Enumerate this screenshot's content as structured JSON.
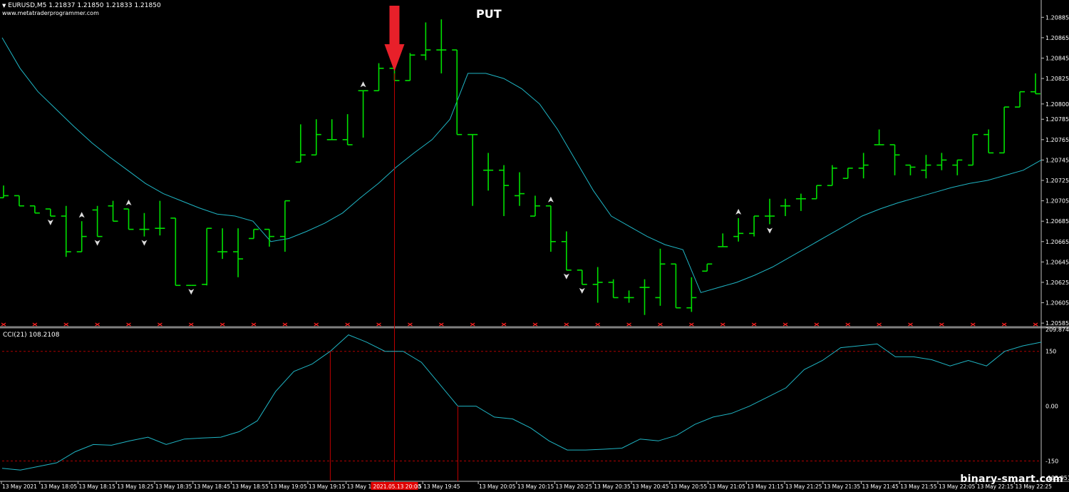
{
  "header": {
    "symbol_line": "EURUSD,M5  1.21837 1.21850 1.21833 1.21850",
    "website": "www.metatraderprogrammer.com"
  },
  "annotation": {
    "signal": "PUT",
    "cursor_time": "2021.05.13 20:00"
  },
  "watermark": "binary-smart.com",
  "colors": {
    "background": "#000000",
    "bar": "#00e000",
    "ma_line": "#1fb5c4",
    "cci_line": "#1fb5c4",
    "marker_red": "#ff2020",
    "cci_level": "#b00000",
    "axis": "#c0c0c0",
    "grid_text": "#ffffff"
  },
  "chart_data": [
    {
      "type": "ohlc",
      "title": "EURUSD,M5",
      "y_ticks": [
        "1.20885",
        "1.20865",
        "1.20845",
        "1.20825",
        "1.20800",
        "1.20785",
        "1.20765",
        "1.20745",
        "1.20725",
        "1.20705",
        "1.20685",
        "1.20665",
        "1.20645",
        "1.20625",
        "1.20605",
        "1.20585"
      ],
      "ylim": [
        1.20583,
        1.20895
      ],
      "bars": [
        [
          1.20708,
          1.2072,
          1.2076,
          1.2071
        ],
        [
          1.2071,
          1.2071,
          1.20718,
          1.207
        ],
        [
          1.207,
          1.207,
          1.207,
          1.20693
        ],
        [
          1.20697,
          1.20697,
          1.20697,
          1.2069
        ],
        [
          1.2069,
          1.207,
          1.2065,
          1.20655
        ],
        [
          1.20655,
          1.20685,
          1.20655,
          1.2067
        ],
        [
          1.20696,
          1.207,
          1.2067,
          1.2067
        ],
        [
          1.207,
          1.20705,
          1.20685,
          1.20685
        ],
        [
          1.20697,
          1.20697,
          1.2068,
          1.20677
        ],
        [
          1.20677,
          1.20693,
          1.2067,
          1.20677
        ],
        [
          1.20678,
          1.20705,
          1.20671,
          1.20678
        ],
        [
          1.20688,
          1.20688,
          1.20622,
          1.20622
        ],
        [
          1.20622,
          1.20622,
          1.20622,
          1.20622
        ],
        [
          1.20623,
          1.20678,
          1.20622,
          1.20678
        ],
        [
          1.20655,
          1.20678,
          1.20648,
          1.20655
        ],
        [
          1.20655,
          1.20678,
          1.2063,
          1.20648
        ],
        [
          1.20668,
          1.20677,
          1.20668,
          1.20677
        ],
        [
          1.20677,
          1.20677,
          1.2066,
          1.2067
        ],
        [
          1.2067,
          1.20705,
          1.20655,
          1.20705
        ],
        [
          1.20743,
          1.2078,
          1.20743,
          1.2075
        ],
        [
          1.2075,
          1.20785,
          1.2075,
          1.2077
        ],
        [
          1.20765,
          1.20785,
          1.20765,
          1.20765
        ],
        [
          1.20765,
          1.2079,
          1.2076,
          1.2076
        ],
        [
          1.20813,
          1.20813,
          1.20767,
          1.20813
        ],
        [
          1.20813,
          1.2084,
          1.20813,
          1.20835
        ],
        [
          1.20835,
          1.20848,
          1.20823,
          1.20823
        ],
        [
          1.20823,
          1.2085,
          1.20823,
          1.20848
        ],
        [
          1.20848,
          1.2088,
          1.20843,
          1.20853
        ],
        [
          1.20853,
          1.20883,
          1.2083,
          1.20853
        ],
        [
          1.20853,
          1.20853,
          1.2077,
          1.2077
        ],
        [
          1.2077,
          1.2077,
          1.207,
          1.2077
        ],
        [
          1.20735,
          1.20752,
          1.20715,
          1.20735
        ],
        [
          1.20735,
          1.2074,
          1.2069,
          1.2072
        ],
        [
          1.2071,
          1.20733,
          1.207,
          1.20712
        ],
        [
          1.2069,
          1.2071,
          1.2069,
          1.207
        ],
        [
          1.207,
          1.207,
          1.20655,
          1.20665
        ],
        [
          1.20665,
          1.20675,
          1.20637,
          1.20637
        ],
        [
          1.20637,
          1.20637,
          1.20623,
          1.20623
        ],
        [
          1.20623,
          1.2064,
          1.20605,
          1.20625
        ],
        [
          1.20625,
          1.20628,
          1.2061,
          1.2061
        ],
        [
          1.2061,
          1.20617,
          1.20605,
          1.2061
        ],
        [
          1.2062,
          1.20628,
          1.20593,
          1.2062
        ],
        [
          1.2061,
          1.20658,
          1.20602,
          1.20643
        ],
        [
          1.20643,
          1.20643,
          1.206,
          1.206
        ],
        [
          1.206,
          1.2063,
          1.20596,
          1.2061
        ],
        [
          1.20636,
          1.20643,
          1.20636,
          1.20643
        ],
        [
          1.2066,
          1.20673,
          1.2066,
          1.2066
        ],
        [
          1.2067,
          1.20688,
          1.20665,
          1.20673
        ],
        [
          1.20673,
          1.2069,
          1.2067,
          1.2069
        ],
        [
          1.2069,
          1.20707,
          1.20682,
          1.2069
        ],
        [
          1.207,
          1.20707,
          1.2069,
          1.207
        ],
        [
          1.20707,
          1.20712,
          1.20695,
          1.20707
        ],
        [
          1.20707,
          1.2072,
          1.2071,
          1.2072
        ],
        [
          1.2072,
          1.2074,
          1.2072,
          1.20737
        ],
        [
          1.20727,
          1.20737,
          1.20727,
          1.20737
        ],
        [
          1.20737,
          1.20752,
          1.20727,
          1.2074
        ],
        [
          1.2076,
          1.20775,
          1.2076,
          1.2076
        ],
        [
          1.2076,
          1.2076,
          1.2073,
          1.2075
        ],
        [
          1.2074,
          1.2074,
          1.2073,
          1.20738
        ],
        [
          1.20735,
          1.2075,
          1.20727,
          1.2074
        ],
        [
          1.2074,
          1.20752,
          1.20735,
          1.20745
        ],
        [
          1.2074,
          1.20745,
          1.2073,
          1.20745
        ],
        [
          1.2074,
          1.2077,
          1.2074,
          1.2077
        ],
        [
          1.2077,
          1.20775,
          1.20755,
          1.20752
        ],
        [
          1.20752,
          1.20797,
          1.20752,
          1.20797
        ],
        [
          1.20797,
          1.2081,
          1.20797,
          1.20812
        ],
        [
          1.20812,
          1.2083,
          1.20812,
          1.2081
        ]
      ],
      "ma": [
        1.20865,
        1.20835,
        1.20812,
        1.20795,
        1.20778,
        1.20762,
        1.20748,
        1.20735,
        1.20722,
        1.20712,
        1.20705,
        1.20698,
        1.20692,
        1.2069,
        1.20685,
        1.20665,
        1.20668,
        1.20675,
        1.20683,
        1.20693,
        1.20708,
        1.20722,
        1.20738,
        1.20752,
        1.20765,
        1.20785,
        1.2083,
        1.2083,
        1.20825,
        1.20815,
        1.208,
        1.20775,
        1.20745,
        1.20715,
        1.2069,
        1.2068,
        1.2067,
        1.20662,
        1.20657,
        1.20615,
        1.2062,
        1.20625,
        1.20632,
        1.2064,
        1.2065,
        1.2066,
        1.2067,
        1.2068,
        1.2069,
        1.20697,
        1.20703,
        1.20708,
        1.20713,
        1.20718,
        1.20722,
        1.20725,
        1.2073,
        1.20735,
        1.20745
      ],
      "ma_x": [
        1,
        3,
        5,
        7,
        9,
        11,
        13,
        15,
        17,
        19,
        21,
        23,
        25,
        27,
        29,
        31,
        33,
        35,
        37,
        39,
        41,
        43,
        45,
        47,
        49,
        51,
        53,
        55,
        57,
        59,
        61,
        63,
        65,
        67,
        69,
        71,
        73,
        75,
        77,
        79,
        81,
        83,
        85,
        87,
        89,
        91,
        93,
        95,
        97,
        99,
        101,
        103,
        105,
        107,
        109,
        111,
        113,
        115,
        117
      ],
      "arrows_up_bars": [
        5,
        8,
        23,
        35,
        47
      ],
      "arrows_down_bars": [
        3,
        6,
        9,
        12,
        36,
        37,
        49
      ],
      "signal_bar": 25
    },
    {
      "type": "line",
      "title": "CCI(21) 108.2108",
      "y_ticks": [
        "209.8741",
        "150",
        "0.00",
        "-150",
        "-195.9519"
      ],
      "ylim": [
        -195.9519,
        209.8741
      ],
      "levels": [
        150,
        -150
      ],
      "values": [
        -170,
        -175,
        -165,
        -155,
        -125,
        -105,
        -107,
        -95,
        -85,
        -105,
        -90,
        -87,
        -85,
        -70,
        -40,
        40,
        95,
        115,
        150,
        195,
        175,
        150,
        150,
        120,
        60,
        0,
        0,
        -30,
        -35,
        -60,
        -95,
        -120,
        -120,
        -118,
        -115,
        -90,
        -95,
        -80,
        -50,
        -30,
        -20,
        0,
        25,
        50,
        100,
        125,
        160,
        165,
        170,
        135,
        135,
        127,
        110,
        125,
        110,
        150,
        165,
        175
      ],
      "vline_points": [
        18,
        25
      ]
    }
  ],
  "x_axis": {
    "labels": [
      "13 May 2021",
      "13 May 18:05",
      "13 May 18:15",
      "13 May 18:25",
      "13 May 18:35",
      "13 May 18:45",
      "13 May 18:55",
      "13 May 19:05",
      "13 May 19:15",
      "13 May 19:25",
      "13 May 19:35",
      "13 May 19:45",
      "13 May 20:05",
      "13 May 20:15",
      "13 May 20:25",
      "13 May 20:35",
      "13 May 20:45",
      "13 May 20:55",
      "13 May 21:05",
      "13 May 21:15",
      "13 May 21:25",
      "13 May 21:35",
      "13 May 21:45",
      "13 May 21:55",
      "13 May 22:05",
      "13 May 22:15",
      "13 May 22:25"
    ]
  }
}
